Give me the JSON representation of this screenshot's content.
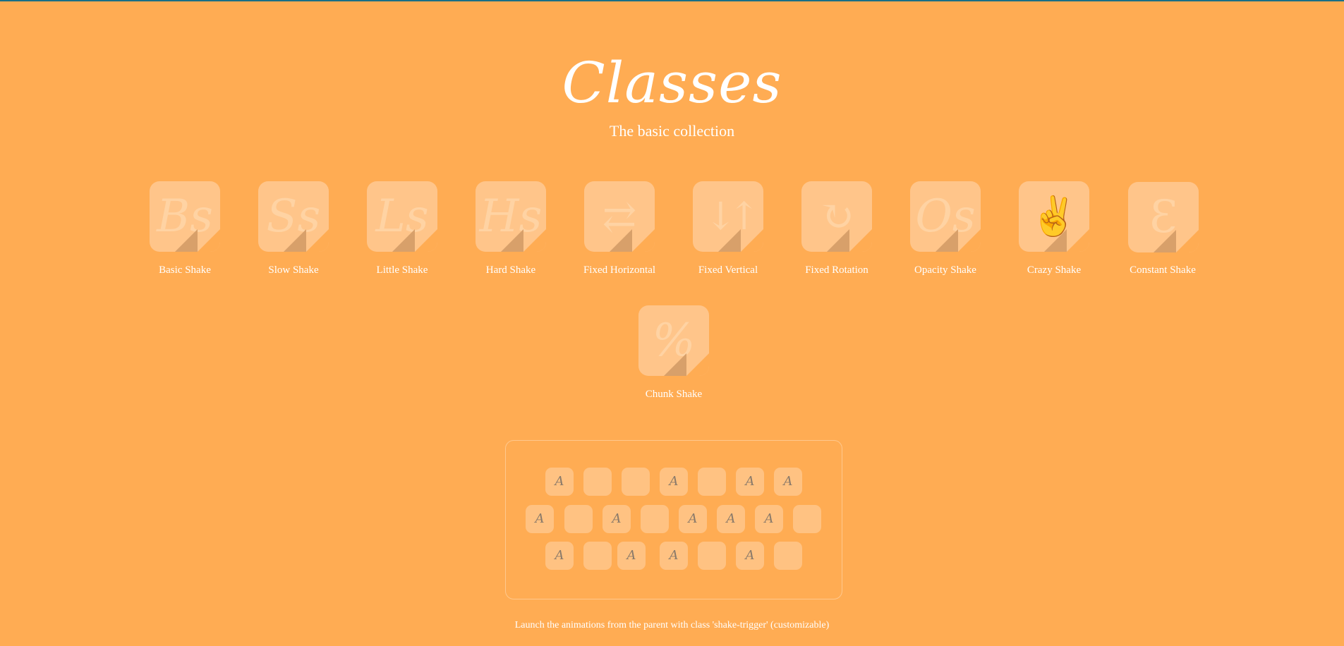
{
  "title": "Classes",
  "subtitle": "The basic collection",
  "colors": {
    "background": "#ffac53",
    "tile": "#ffc58a",
    "key": "#ffc282",
    "text": "#ffffff"
  },
  "tiles": [
    {
      "glyph": "Bs",
      "label": "Basic Shake"
    },
    {
      "glyph": "Ss",
      "label": "Slow Shake"
    },
    {
      "glyph": "Ls",
      "label": "Little Shake"
    },
    {
      "glyph": "Hs",
      "label": "Hard Shake"
    },
    {
      "glyph": "⇄",
      "label": "Fixed Horizontal"
    },
    {
      "glyph": "↓↑",
      "label": "Fixed Vertical"
    },
    {
      "glyph": "↻",
      "label": "Fixed Rotation"
    },
    {
      "glyph": "Os",
      "label": "Opacity Shake"
    },
    {
      "glyph": "✌",
      "label": "Crazy Shake"
    },
    {
      "glyph": "Ɛ",
      "label": "Constant Shake"
    },
    {
      "glyph": "%",
      "label": "Chunk Shake"
    }
  ],
  "keyboard": {
    "rows": [
      [
        "A",
        "",
        "",
        "A",
        "",
        "A",
        "A"
      ],
      [
        "A",
        "",
        "A",
        "",
        "A",
        "A",
        "A",
        ""
      ],
      [
        "A",
        "",
        "A",
        "A",
        "",
        "A",
        ""
      ]
    ]
  },
  "footer": "Launch the animations from the parent with class 'shake-trigger' (customizable)"
}
